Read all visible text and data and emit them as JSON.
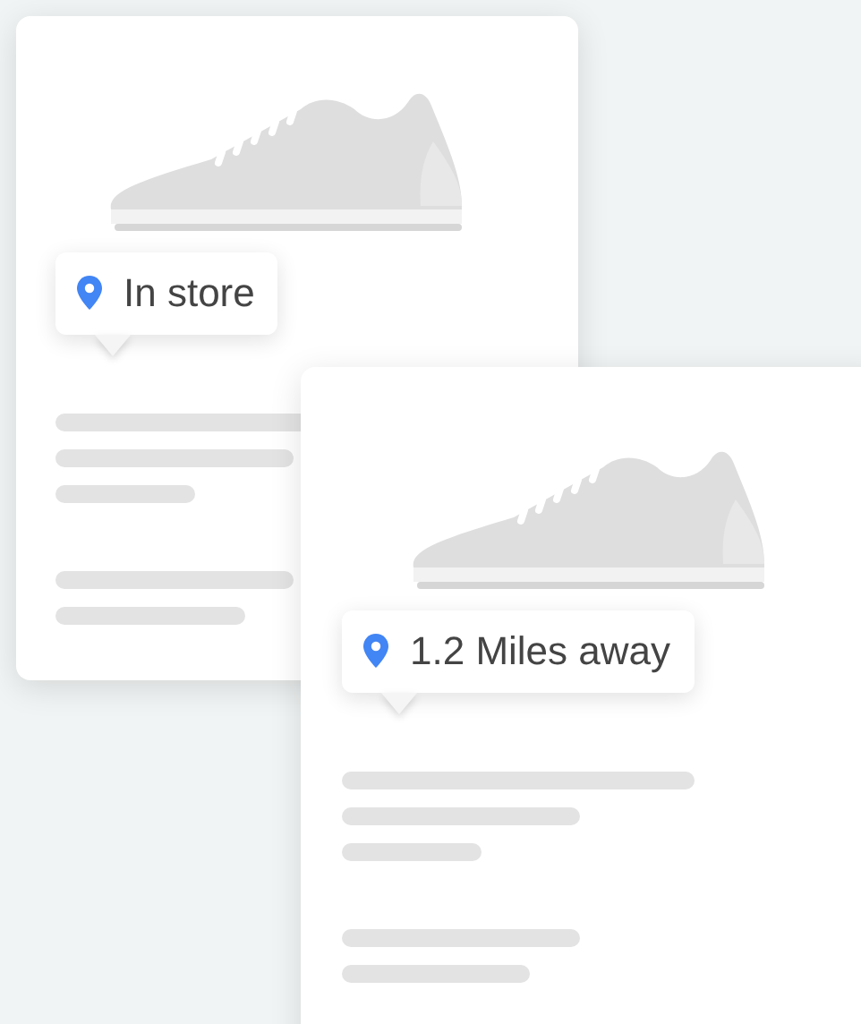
{
  "cards": [
    {
      "location": "In store"
    },
    {
      "location": "1.2 Miles away"
    }
  ]
}
